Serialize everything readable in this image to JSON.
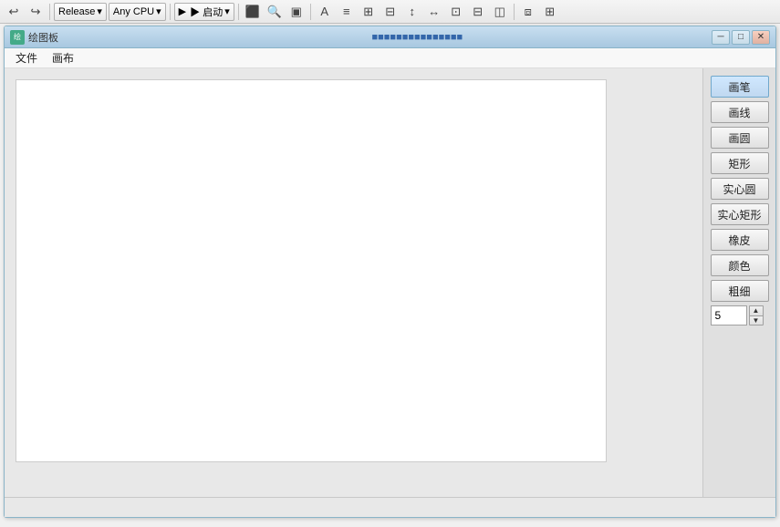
{
  "ide": {
    "toolbar": {
      "undo_label": "↩",
      "redo_label": "↪",
      "config_dropdown": "Release",
      "platform_dropdown": "Any CPU",
      "start_btn": "▶ 启动",
      "start_arrow": "▾"
    },
    "window": {
      "icon_text": "绘",
      "title": "绘图板",
      "title_path": "...",
      "minimize_icon": "─",
      "restore_icon": "□",
      "close_icon": "✕"
    },
    "menubar": {
      "items": [
        "文件",
        "画布"
      ]
    },
    "tools": {
      "buttons": [
        "画笔",
        "画线",
        "画圆",
        "矩形",
        "实心圆",
        "实心矩形",
        "橡皮",
        "颜色",
        "粗细"
      ],
      "size_value": "5"
    },
    "statusbar": {
      "text": ""
    }
  }
}
